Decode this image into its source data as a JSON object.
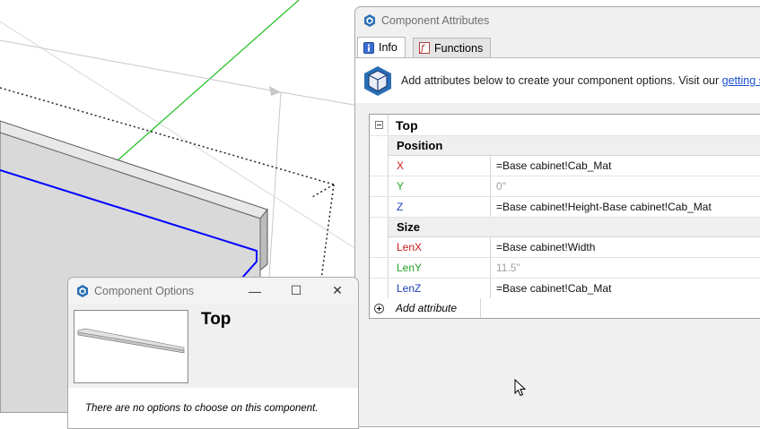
{
  "attributes_window": {
    "title": "Component Attributes",
    "tabs": [
      {
        "label": "Info",
        "icon": "info-icon",
        "active": true
      },
      {
        "label": "Functions",
        "icon": "function-icon",
        "active": false
      }
    ],
    "info_text": "Add attributes below to create your component options. Visit our ",
    "info_link": "getting st",
    "component_name": "Top",
    "sections": [
      {
        "name": "Position",
        "rows": [
          {
            "label": "X",
            "color": "red",
            "value": "=Base cabinet!Cab_Mat",
            "muted": false
          },
          {
            "label": "Y",
            "color": "green",
            "value": "0\"",
            "muted": true
          },
          {
            "label": "Z",
            "color": "blue",
            "value": "=Base cabinet!Height-Base cabinet!Cab_Mat",
            "muted": false
          }
        ]
      },
      {
        "name": "Size",
        "rows": [
          {
            "label": "LenX",
            "color": "red",
            "value": "=Base cabinet!Width",
            "muted": false
          },
          {
            "label": "LenY",
            "color": "green",
            "value": "11.5\"",
            "muted": true
          },
          {
            "label": "LenZ",
            "color": "blue",
            "value": "=Base cabinet!Cab_Mat",
            "muted": false
          }
        ]
      }
    ],
    "add_attribute_label": "Add attribute"
  },
  "options_window": {
    "title": "Component Options",
    "component_title": "Top",
    "message": "There are no options to choose on this component.",
    "controls": {
      "minimize": "—",
      "maximize": "☐",
      "close": "✕"
    }
  },
  "colors": {
    "axis_red": "#cc1a1a",
    "axis_green": "#22a022",
    "axis_blue": "#1c3fb8",
    "selection_blue": "#0000ff"
  }
}
